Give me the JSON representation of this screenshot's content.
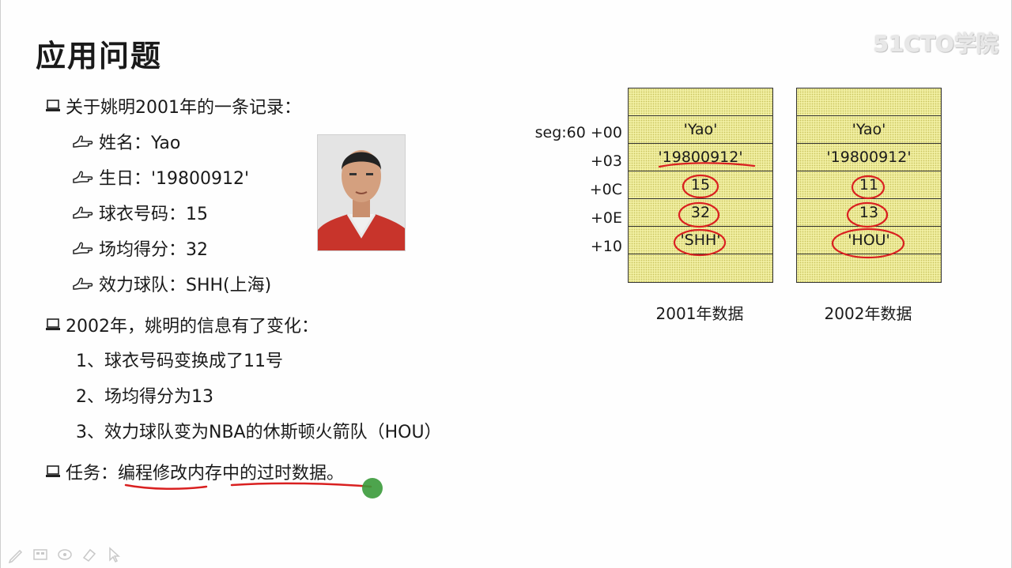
{
  "slide": {
    "title": "应用问题",
    "watermark": "51CTO学院",
    "record_heading": "关于姚明2001年的一条记录：",
    "record_items": [
      "姓名：Yao",
      "生日：'19800912'",
      "球衣号码：15",
      "场均得分：32",
      "效力球队：SHH(上海)"
    ],
    "change_heading": "2002年，姚明的信息有了变化：",
    "changes": [
      "1、球衣号码变换成了11号",
      "2、场均得分为13",
      "3、效力球队变为NBA的休斯顿火箭队（HOU）"
    ],
    "task_label": "任务：",
    "task_text": "编程修改内存中的过时数据。"
  },
  "memory": {
    "offsets": [
      "seg:60  +00",
      "+03",
      "+0C",
      "+0E",
      "+10"
    ],
    "table_2001": {
      "cells": [
        "",
        "'Yao'",
        "'19800912'",
        "15",
        "32",
        "'SHH'",
        ""
      ],
      "caption": "2001年数据"
    },
    "table_2002": {
      "cells": [
        "",
        "'Yao'",
        "'19800912'",
        "11",
        "13",
        "'HOU'",
        ""
      ],
      "caption": "2002年数据"
    }
  },
  "colors": {
    "table_fill": "#f1efa2",
    "annotation": "#d92020",
    "pointer": "#3a9a3a"
  }
}
